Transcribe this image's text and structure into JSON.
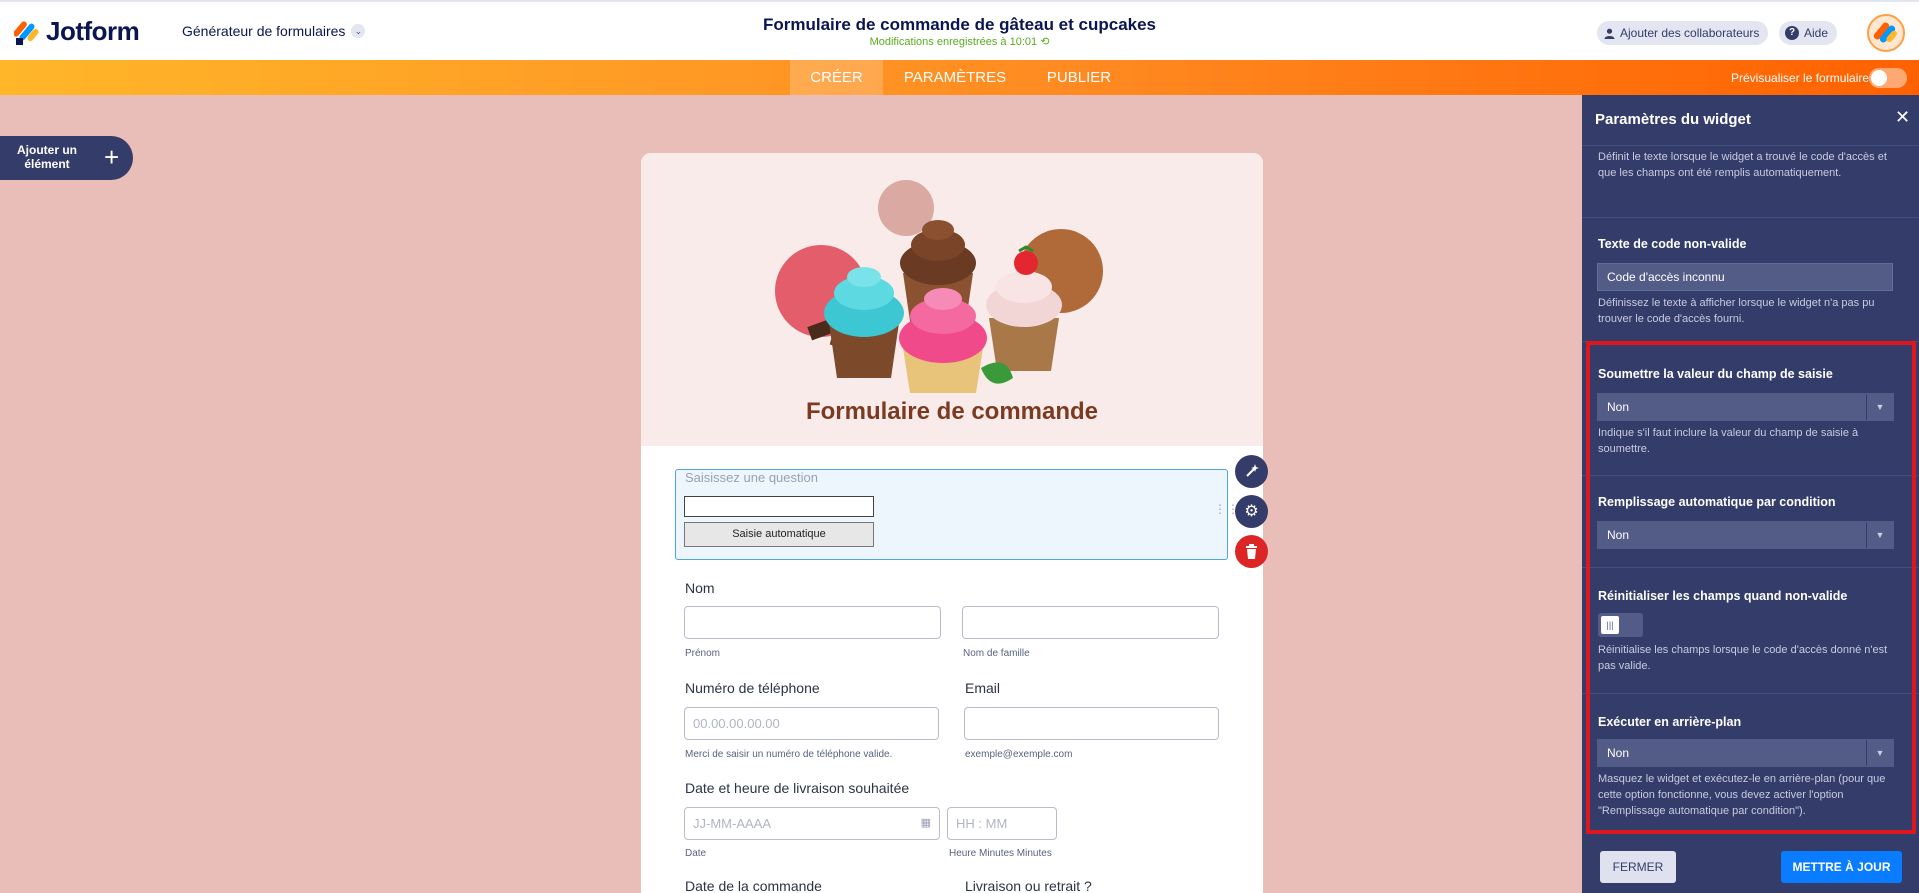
{
  "header": {
    "logo_text": "Jotform",
    "builder_dropdown": "Générateur de formulaires",
    "form_title": "Formulaire de commande de gâteau et cupcakes",
    "save_status": "Modifications enregistrées à 10:01",
    "add_collaborators": "Ajouter des collaborateurs",
    "help": "Aide"
  },
  "nav": {
    "tabs": [
      "CRÉER",
      "PARAMÈTRES",
      "PUBLIER"
    ],
    "active_tab": "CRÉER",
    "preview_label": "Prévisualiser le formulaire",
    "preview_on": false
  },
  "add_element": {
    "label": "Ajouter un élément"
  },
  "form": {
    "title": "Formulaire de commande",
    "widget": {
      "question_placeholder": "Saisissez une question",
      "button_label": "Saisie automatique"
    },
    "fields": {
      "name_label": "Nom",
      "first_name_sub": "Prénom",
      "last_name_sub": "Nom de famille",
      "phone_label": "Numéro de téléphone",
      "phone_placeholder": "00.00.00.00.00",
      "phone_sub": "Merci de saisir un numéro de téléphone valide.",
      "email_label": "Email",
      "email_sub": "exemple@exemple.com",
      "delivery_label": "Date et heure de livraison souhaitée",
      "date_placeholder": "JJ-MM-AAAA",
      "time_placeholder": "HH : MM",
      "date_sub": "Date",
      "time_sub": "Heure Minutes Minutes",
      "order_date_label": "Date de la commande",
      "delivery_or_pickup_label": "Livraison ou retrait ?"
    }
  },
  "panel": {
    "title": "Paramètres du widget",
    "top_description": "Définit le texte lorsque le widget a trouvé le code d'accès et que les champs ont été remplis automatiquement.",
    "invalid_code_label": "Texte de code non-valide",
    "invalid_code_value": "Code d'accès inconnu",
    "invalid_code_desc": "Définissez le texte à afficher lorsque le widget n'a pas pu trouver le code d'accès fourni.",
    "submit_value_label": "Soumettre la valeur du champ de saisie",
    "submit_value_selected": "Non",
    "submit_value_desc": "Indique s'il faut inclure la valeur du champ de saisie à soumettre.",
    "autofill_label": "Remplissage automatique par condition",
    "autofill_selected": "Non",
    "reset_label": "Réinitialiser les champs quand non-valide",
    "reset_on": false,
    "reset_desc": "Réinitialise les champs lorsque le code d'accès donné n'est pas valide.",
    "background_label": "Exécuter en arrière-plan",
    "background_selected": "Non",
    "background_desc": "Masquez le widget et exécutez-le en arrière-plan (pour que cette option fonctionne, vous devez activer l'option \"Remplissage automatique par condition\").",
    "close_button": "FERMER",
    "update_button": "METTRE À JOUR"
  },
  "colors": {
    "brand_orange": "#ff6100",
    "panel_bg": "#343c6a",
    "canvas_bg": "#e9bdb8",
    "highlight_red": "#e0161f",
    "update_blue": "#0a7cff"
  }
}
